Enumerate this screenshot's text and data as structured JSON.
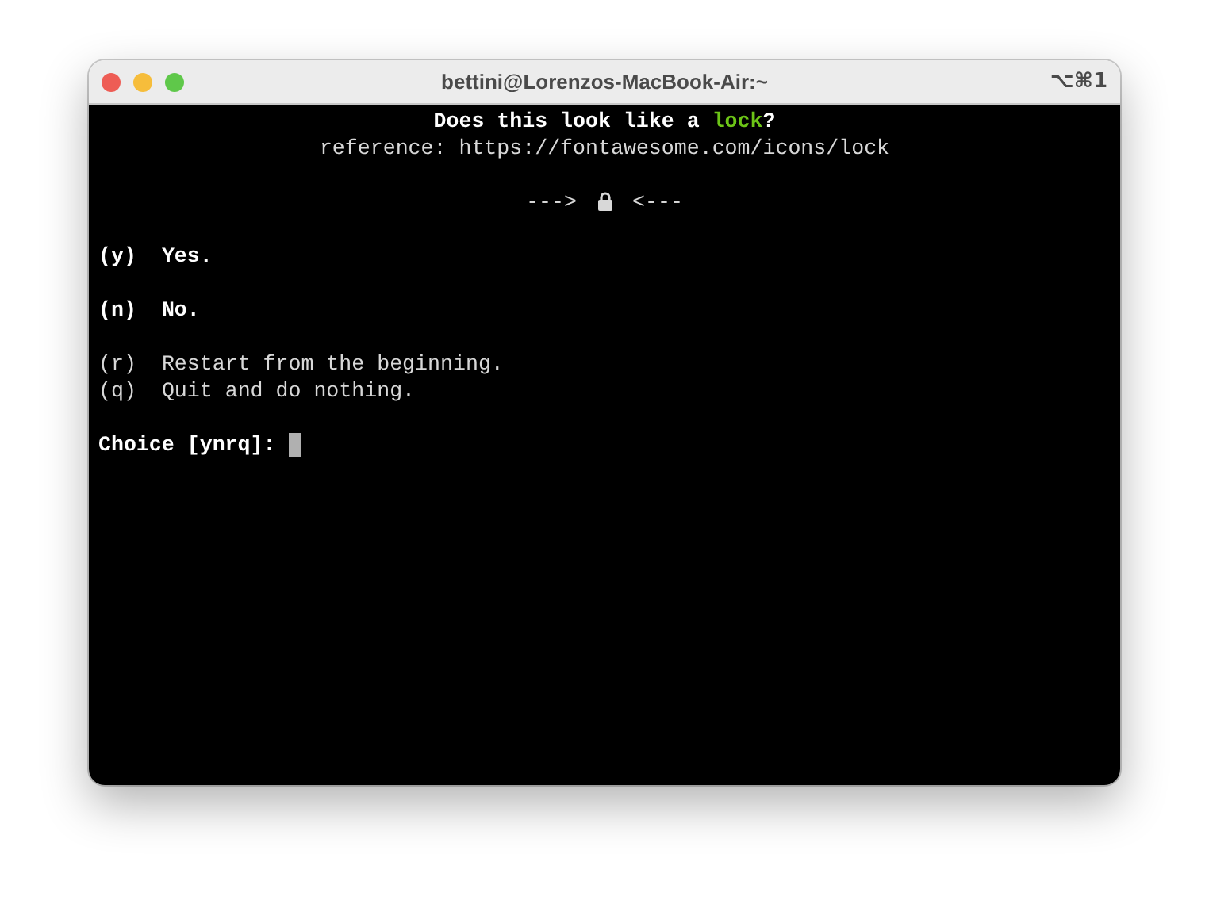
{
  "window": {
    "title": "bettini@Lorenzos-MacBook-Air:~",
    "shortcut": "⌥⌘1"
  },
  "terminal": {
    "question": [
      {
        "kind": "plain",
        "text": "Does this look like a "
      },
      {
        "kind": "highlight",
        "text": "lock"
      },
      {
        "kind": "plain",
        "text": "?"
      }
    ],
    "reference": "reference: https://fontawesome.com/icons/lock",
    "pointer_left": "--->",
    "pointer_right": "<---",
    "option_groups": [
      {
        "emphasis": true,
        "options": [
          {
            "key": "(y)",
            "label": "Yes."
          }
        ]
      },
      {
        "emphasis": true,
        "options": [
          {
            "key": "(n)",
            "label": "No."
          }
        ]
      },
      {
        "emphasis": false,
        "options": [
          {
            "key": "(r)",
            "label": "Restart from the beginning."
          },
          {
            "key": "(q)",
            "label": "Quit and do nothing."
          }
        ]
      }
    ],
    "prompt": "Choice [ynrq]:"
  }
}
